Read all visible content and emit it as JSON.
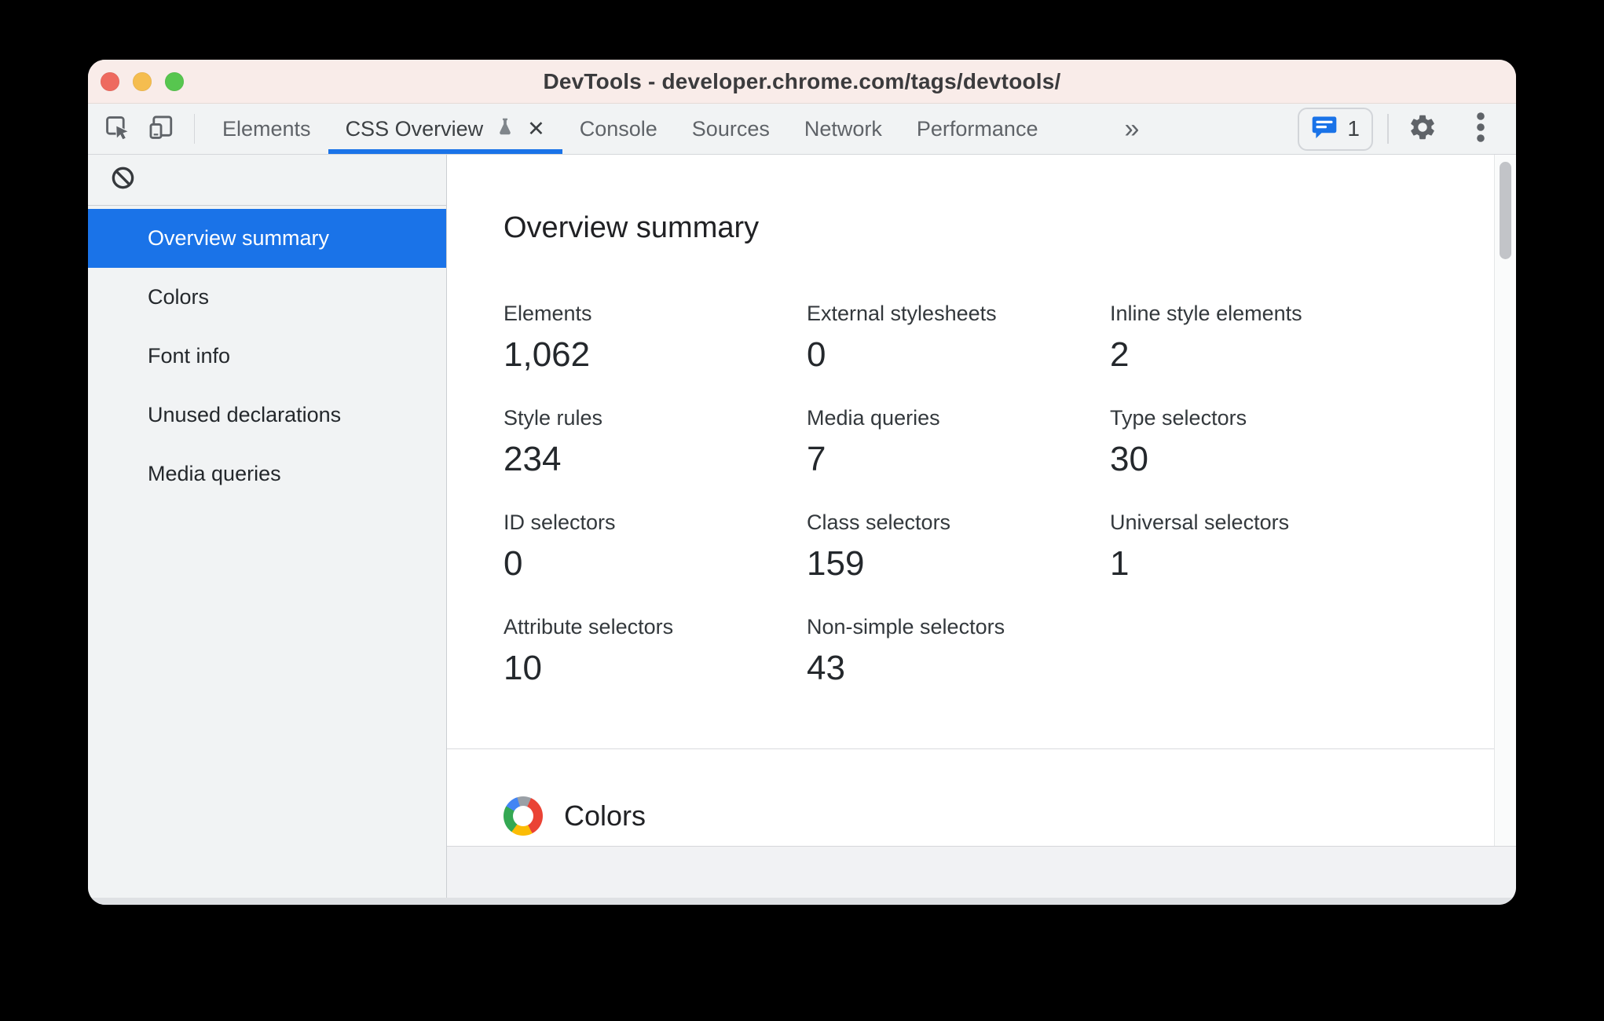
{
  "window": {
    "title": "DevTools - developer.chrome.com/tags/devtools/"
  },
  "tabbar": {
    "tabs": [
      {
        "label": "Elements"
      },
      {
        "label": "CSS Overview",
        "active": true,
        "has_flask_icon": true,
        "close_label": "✕"
      },
      {
        "label": "Console"
      },
      {
        "label": "Sources"
      },
      {
        "label": "Network"
      },
      {
        "label": "Performance"
      }
    ],
    "more_tabs_label": "»",
    "messages_badge_count": "1"
  },
  "sidebar": {
    "items": [
      {
        "label": "Overview summary",
        "selected": true
      },
      {
        "label": "Colors"
      },
      {
        "label": "Font info"
      },
      {
        "label": "Unused declarations"
      },
      {
        "label": "Media queries"
      }
    ]
  },
  "main": {
    "heading": "Overview summary",
    "stats": [
      {
        "label": "Elements",
        "value": "1,062"
      },
      {
        "label": "External stylesheets",
        "value": "0"
      },
      {
        "label": "Inline style elements",
        "value": "2"
      },
      {
        "label": "Style rules",
        "value": "234"
      },
      {
        "label": "Media queries",
        "value": "7"
      },
      {
        "label": "Type selectors",
        "value": "30"
      },
      {
        "label": "ID selectors",
        "value": "0"
      },
      {
        "label": "Class selectors",
        "value": "159"
      },
      {
        "label": "Universal selectors",
        "value": "1"
      },
      {
        "label": "Attribute selectors",
        "value": "10"
      },
      {
        "label": "Non-simple selectors",
        "value": "43"
      }
    ],
    "colors_section": {
      "title": "Colors"
    }
  },
  "colors": {
    "accent_blue": "#1a73e8",
    "titlebar_bg": "#f9ece9",
    "chrome_bg": "#f1f3f4",
    "traffic_red": "#ee6a5f",
    "traffic_yellow": "#f5bd4f",
    "traffic_green": "#57c64f",
    "ring_segments": [
      "#9aa0a6",
      "#ea4335",
      "#fbbc05",
      "#34a853",
      "#4285f4"
    ]
  }
}
